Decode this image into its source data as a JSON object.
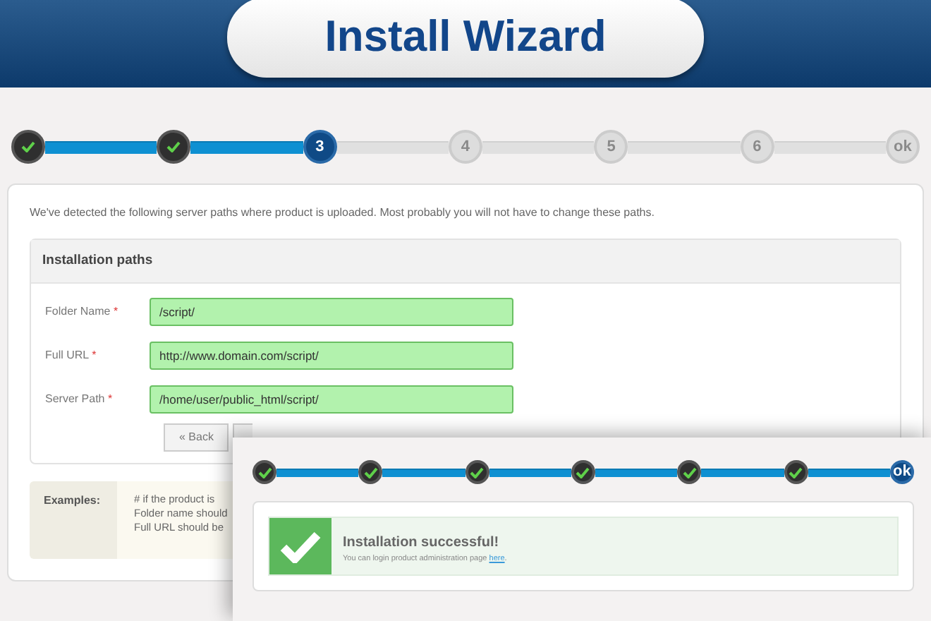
{
  "header": {
    "title": "Install Wizard"
  },
  "steps": [
    {
      "done": true,
      "current": false
    },
    {
      "done": true,
      "current": false
    },
    {
      "done": false,
      "current": true,
      "label": "3"
    },
    {
      "done": false,
      "current": false,
      "label": "4"
    },
    {
      "done": false,
      "current": false,
      "label": "5"
    },
    {
      "done": false,
      "current": false,
      "label": "6"
    },
    {
      "done": false,
      "current": false,
      "label": "ok"
    }
  ],
  "intro": "We've detected the following server paths where product is uploaded. Most probably you will not have to change these paths.",
  "paths": {
    "title": "Installation paths",
    "fields": [
      {
        "label": "Folder Name",
        "required_mark": "*",
        "value": "/script/"
      },
      {
        "label": "Full URL",
        "required_mark": "*",
        "value": "http://www.domain.com/script/"
      },
      {
        "label": "Server Path",
        "required_mark": "*",
        "value": "/home/user/public_html/script/"
      }
    ],
    "back_button": "« Back"
  },
  "examples": {
    "title": "Examples:",
    "lines": [
      "# if the product is",
      "Folder name should",
      "Full URL should be"
    ]
  },
  "overlay": {
    "steps": [
      {
        "done": true,
        "current": false
      },
      {
        "done": true,
        "current": false
      },
      {
        "done": true,
        "current": false
      },
      {
        "done": true,
        "current": false
      },
      {
        "done": true,
        "current": false
      },
      {
        "done": true,
        "current": false
      },
      {
        "done": false,
        "current": true,
        "label": "ok"
      }
    ],
    "success": {
      "title": "Installation successful!",
      "text": "You can login product administration page ",
      "link": "here",
      "after": "."
    }
  }
}
